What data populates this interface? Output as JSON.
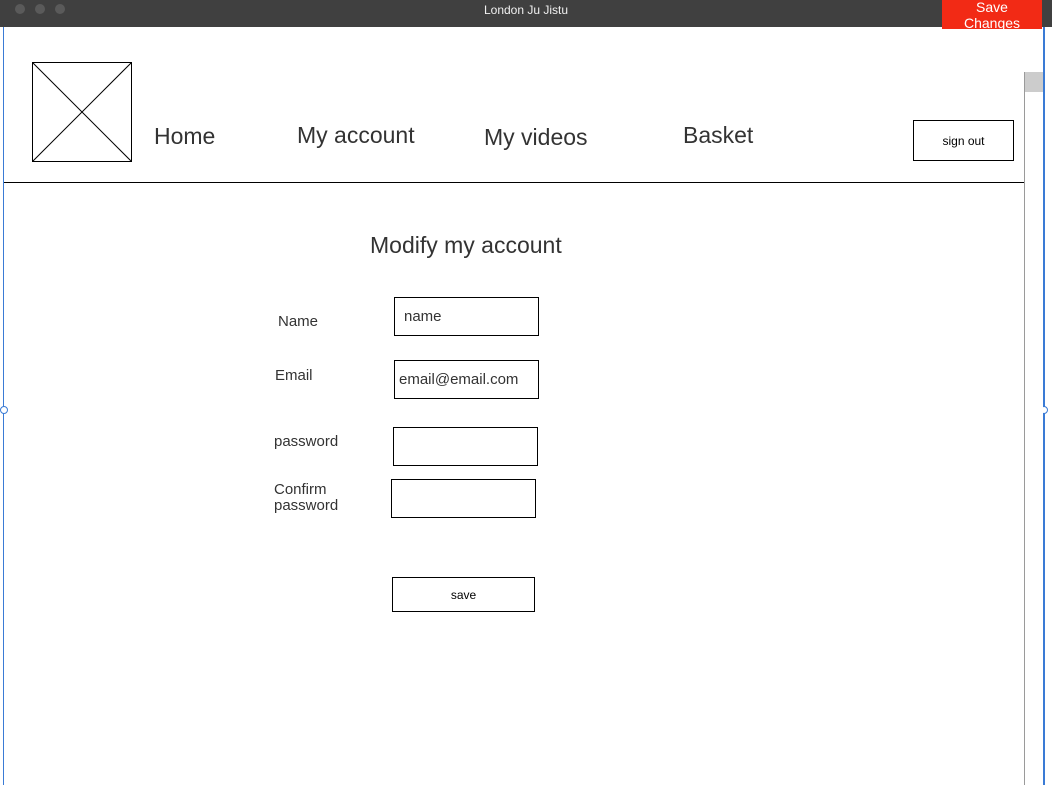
{
  "window": {
    "title": "London Ju Jistu"
  },
  "toolbar": {
    "save_changes_label": "Save Changes"
  },
  "nav": {
    "links": [
      "Home",
      "My account",
      "My videos",
      "Basket"
    ],
    "sign_out_label": "sign out"
  },
  "page": {
    "title": "Modify my account"
  },
  "form": {
    "name": {
      "label": "Name",
      "value": "",
      "placeholder": "name"
    },
    "email": {
      "label": "Email",
      "value": "",
      "placeholder": "email@email.com"
    },
    "password": {
      "label": "password",
      "value": ""
    },
    "confirm_password": {
      "label": "Confirm password",
      "value": ""
    },
    "save_label": "save"
  },
  "colors": {
    "titlebar": "#404040",
    "save_changes_bg": "#f22a15",
    "frame_accent": "#3a7bd5"
  },
  "icons": {
    "logo": "image-placeholder-icon"
  }
}
